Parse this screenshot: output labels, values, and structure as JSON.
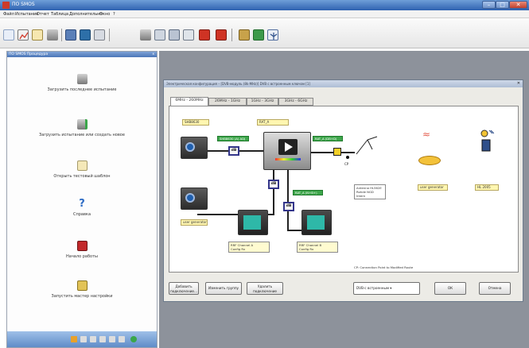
{
  "window": {
    "title": "ПО SMOS",
    "min": "–",
    "max": "□",
    "close": "✕"
  },
  "menu": [
    "Файл",
    "Испытание",
    "Отчет",
    "Таблица",
    "Дополнительно",
    "Окно",
    "?"
  ],
  "toolbar_icons": [
    "new-file-icon",
    "chart-icon",
    "document-icon",
    "database-icon",
    "print-icon",
    "monitor-icon",
    "settings-icon",
    "server-icon",
    "network-icon",
    "display-icon",
    "tool-red-icon",
    "tool-red-2-icon",
    "tools-icon",
    "plug-icon",
    "antenna-icon"
  ],
  "sidebar": {
    "header": "ПО SMOS Процедура",
    "close": "x",
    "tasks": [
      {
        "label": "Загрузить последнее испытание",
        "icon": "database-icon"
      },
      {
        "label": "Загрузить испытание или создать новое",
        "icon": "database-add-icon"
      },
      {
        "label": "Открыть тестовый шаблон",
        "icon": "document-icon"
      },
      {
        "label": "Справка",
        "icon": "help-icon"
      },
      {
        "label": "Начало работы",
        "icon": "book-icon"
      },
      {
        "label": "Запустить мастер настройки",
        "icon": "wizard-icon"
      }
    ]
  },
  "dialog": {
    "title": "Электрическая конфигурация – [DVB-модуль (8k-MHz)] DVB с встроенным ключом [1]",
    "tabs": [
      "6MHz - 260MHz",
      "26MHz - 1GHz",
      "1GHz - 3GHz",
      "3GHz - 6GHz"
    ],
    "labels": {
      "generator_top": "SHB8630",
      "rat": "RAT_A",
      "generator_bottom": "user generator",
      "green_1": "SHB8630 (A) ADJ",
      "green_2": "RAT_A (DB+D) ADJ",
      "green_3": "RAT_A (N+B+) Cmdr",
      "antenna_box_1": "Antenna HL562E",
      "antenna_box_2": "Rohde NGD Intern",
      "user_generator_right": "user generator",
      "hl": "HL 2005",
      "rx_a_1": "RRF Channel A",
      "rx_a_2": "Config Rx",
      "rx_b_1": "RRF Channel B",
      "rx_b_2": "Config Rx",
      "cp": "CP",
      "db": "dB",
      "cp_note": "CP: Connection Point to Modified Route"
    },
    "buttons": {
      "add": "Добавить подключение...",
      "change": "Изменить группу",
      "remove": "Удалить подключение",
      "select": "DVB-с встроенным ▾",
      "ok": "ОК",
      "cancel": "Отмена"
    }
  },
  "colors": {
    "accent": "#2f62b0",
    "green": "#3ea64b",
    "yellow_label": "#fff6b0",
    "db_border": "#33358a"
  }
}
